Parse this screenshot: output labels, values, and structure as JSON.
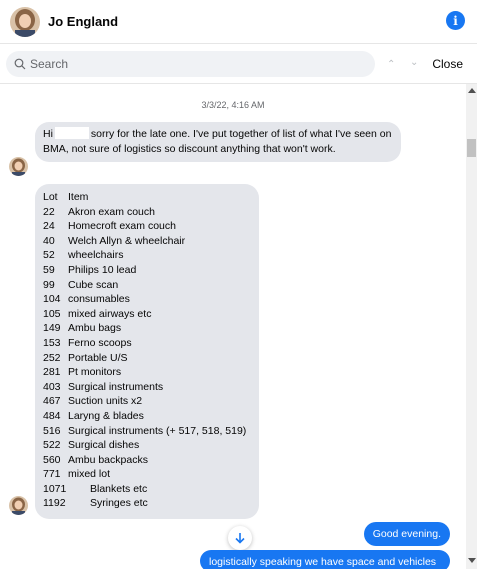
{
  "header": {
    "contact_name": "Jo England",
    "info_icon": "info-icon"
  },
  "search": {
    "placeholder": "Search",
    "close_label": "Close"
  },
  "conversation": {
    "timestamp": "3/3/22, 4:16 AM",
    "message1": {
      "greeting": "Hi",
      "text": "sorry for the late one. I've put together of list of what I've seen on BMA, not sure of logistics so discount anything that won't work."
    },
    "lot_list": {
      "header_lot": "Lot",
      "header_item": "Item",
      "rows": [
        {
          "lot": "22",
          "item": "Akron exam couch"
        },
        {
          "lot": "24",
          "item": "Homecroft exam couch"
        },
        {
          "lot": "40",
          "item": "Welch Allyn & wheelchair"
        },
        {
          "lot": "52",
          "item": "wheelchairs"
        },
        {
          "lot": "59",
          "item": "Philips 10 lead"
        },
        {
          "lot": "99",
          "item": "Cube scan"
        },
        {
          "lot": "104",
          "item": "consumables"
        },
        {
          "lot": "105",
          "item": "mixed airways etc"
        },
        {
          "lot": "149",
          "item": "Ambu bags"
        },
        {
          "lot": "153",
          "item": "Ferno scoops"
        },
        {
          "lot": "252",
          "item": "Portable U/S"
        },
        {
          "lot": "281",
          "item": "Pt monitors"
        },
        {
          "lot": "403",
          "item": "Surgical instruments"
        },
        {
          "lot": "467",
          "item": "Suction units x2"
        },
        {
          "lot": "484",
          "item": "Laryng & blades"
        },
        {
          "lot": "516",
          "item": "Surgical instruments (+ 517, 518, 519)"
        },
        {
          "lot": "522",
          "item": "Surgical dishes"
        },
        {
          "lot": "560",
          "item": "Ambu backpacks"
        },
        {
          "lot": "771",
          "item": "mixed lot"
        },
        {
          "lot": "1071",
          "item": "Blankets etc"
        },
        {
          "lot": "1192",
          "item": "Syringes etc"
        }
      ]
    },
    "outgoing1": "Good evening.",
    "outgoing2": "logistically speaking we have space and vehicles"
  },
  "colors": {
    "accent": "#1877f2",
    "incoming_bubble": "#e4e6eb"
  }
}
